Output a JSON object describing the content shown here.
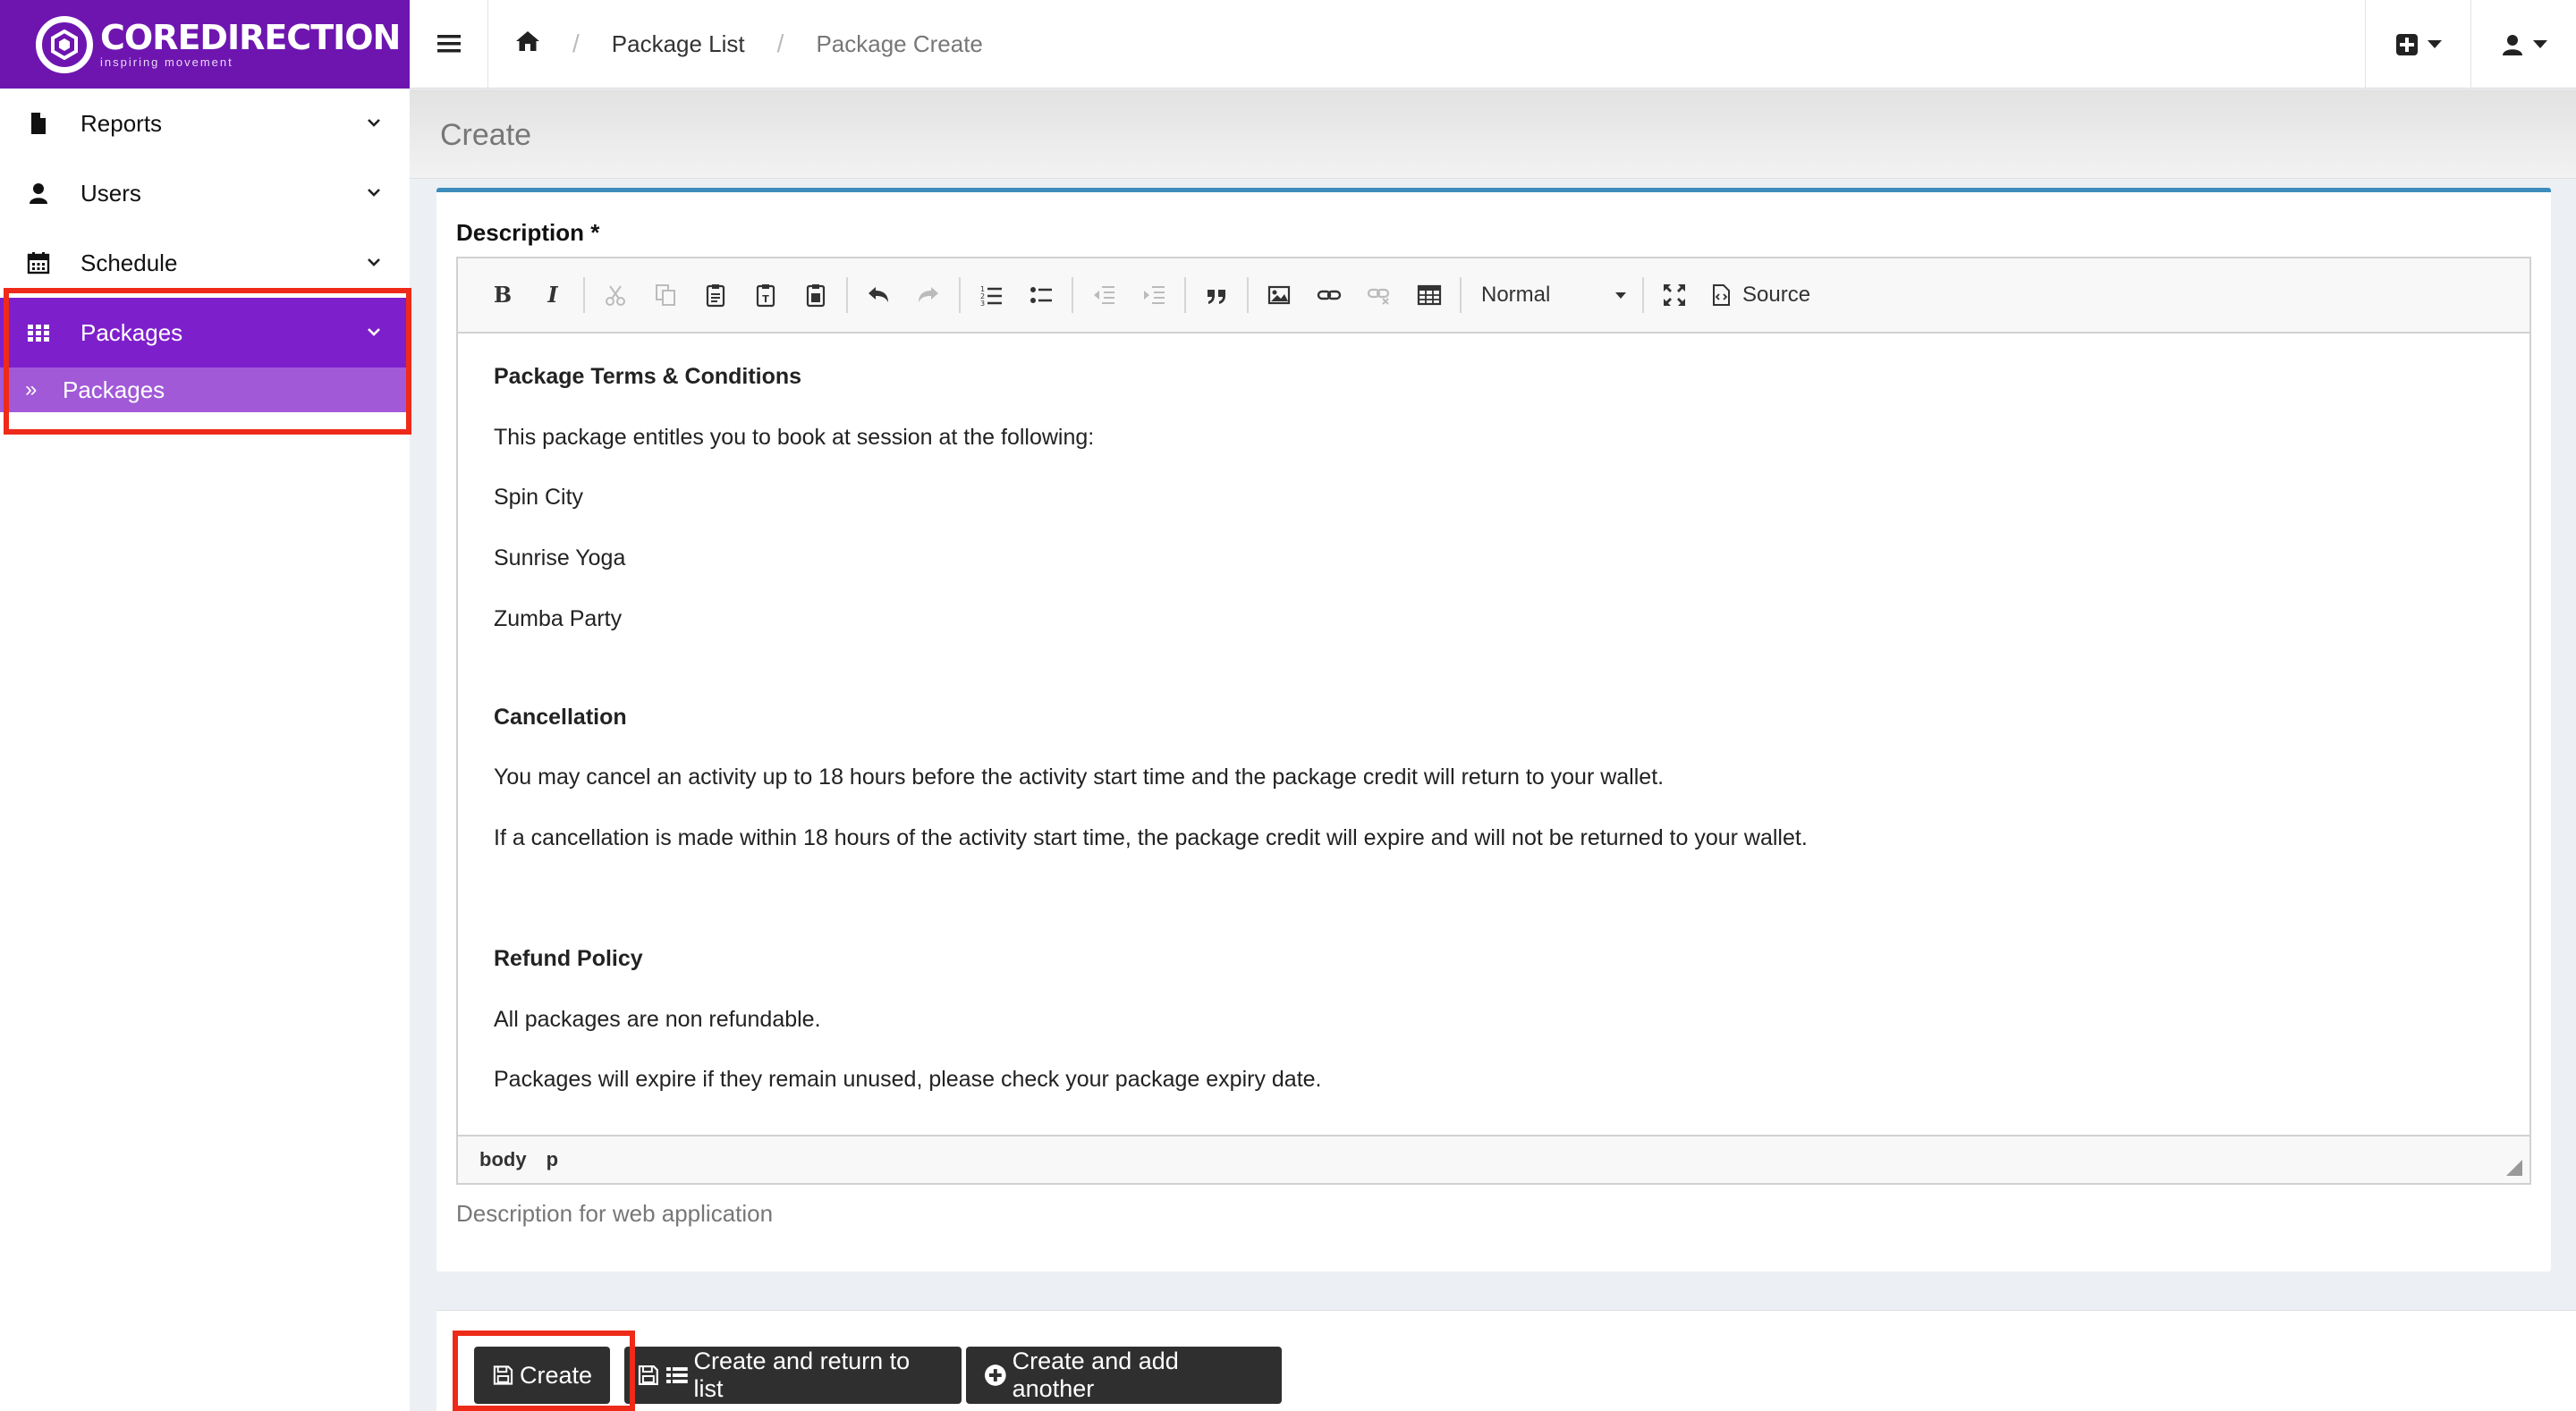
{
  "brand": {
    "name": "COREDIRECTION",
    "tagline": "inspiring movement",
    "color": "#6e15b0"
  },
  "breadcrumb": {
    "items": [
      "Package List",
      "Package Create"
    ]
  },
  "sidebar": {
    "items": [
      {
        "label": "Reports",
        "icon": "file-icon"
      },
      {
        "label": "Users",
        "icon": "user-icon"
      },
      {
        "label": "Schedule",
        "icon": "calendar-icon"
      },
      {
        "label": "Packages",
        "icon": "grid-icon"
      }
    ],
    "sub_item": "Packages",
    "active_color": "#7e1fcc"
  },
  "page": {
    "title": "Create"
  },
  "form": {
    "label": "Description *",
    "help": "Description for web application"
  },
  "editor": {
    "format_select": "Normal",
    "source_label": "Source",
    "path": [
      "body",
      "p"
    ],
    "content": [
      {
        "text": "Package Terms & Conditions",
        "bold": true
      },
      {
        "text": "This package entitles you to book at session at the following:"
      },
      {
        "text": "Spin City"
      },
      {
        "text": "Sunrise Yoga"
      },
      {
        "text": "Zumba Party"
      },
      {
        "text": "Cancellation",
        "bold": true
      },
      {
        "text": "You may cancel an activity up to 18 hours before the activity start time and the package credit will return to your wallet."
      },
      {
        "text": "If a cancellation is made within 18 hours of the activity start time, the package credit will expire and will not be returned to your wallet."
      },
      {
        "text": "Refund Policy",
        "bold": true
      },
      {
        "text": "All packages are non refundable."
      },
      {
        "text": "Packages will expire if they remain unused, please check your package expiry date."
      }
    ]
  },
  "actions": {
    "create": "Create",
    "create_return": "Create and return to list",
    "create_another": "Create and add another"
  },
  "highlight_color": "#ee2a19"
}
